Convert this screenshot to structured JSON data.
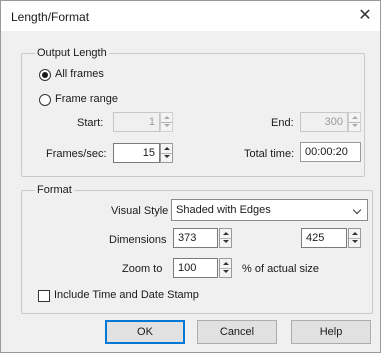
{
  "window": {
    "title": "Length/Format",
    "close_glyph": "✕"
  },
  "output_length": {
    "legend": "Output Length",
    "all_frames_label": "All frames",
    "frame_range_label": "Frame range",
    "selected": "All frames",
    "start_label": "Start:",
    "start_value": "1",
    "end_label": "End:",
    "end_value": "300",
    "fps_label": "Frames/sec:",
    "fps_value": "15",
    "total_time_label": "Total time:",
    "total_time_value": "00:00:20"
  },
  "format": {
    "legend": "Format",
    "visual_style_label": "Visual Style",
    "visual_style_value": "Shaded with Edges",
    "dimensions_label": "Dimensions",
    "width_value": "373",
    "height_value": "425",
    "zoom_label": "Zoom to",
    "zoom_value": "100",
    "zoom_suffix": "% of actual size",
    "stamp_label": "Include Time and Date Stamp",
    "stamp_checked": false
  },
  "buttons": {
    "ok": "OK",
    "cancel": "Cancel",
    "help": "Help"
  },
  "colors": {
    "dialog_bg": "#f0f0f0",
    "default_button_border": "#0078d7"
  }
}
